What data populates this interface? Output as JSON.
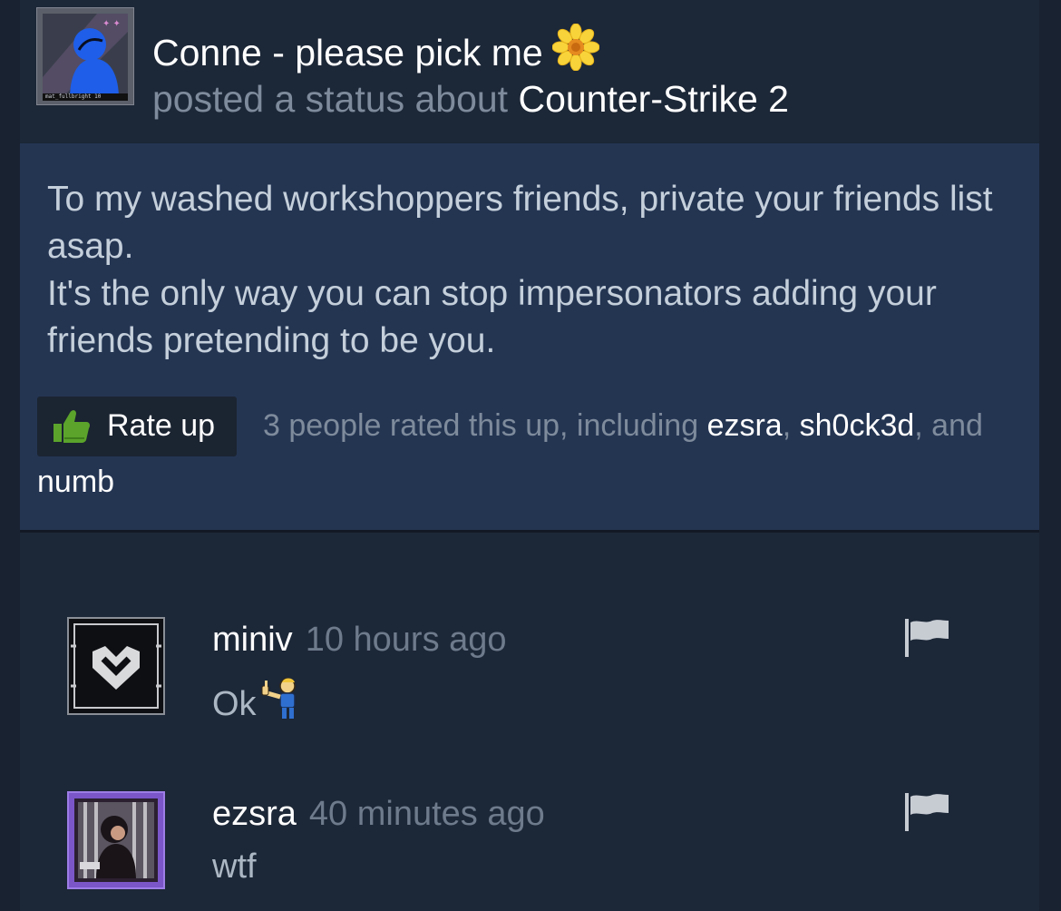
{
  "post": {
    "author": "Conne - please pick me",
    "author_emoji_icon": "sunflower-icon",
    "action_text": "posted a status about",
    "game": "Counter-Strike 2",
    "avatar_caption": "mat_fullbright 10",
    "status_text": "To my washed workshoppers friends, private your friends list asap.\nIt's the only way you can stop impersonators adding your friends pretending to be you.",
    "rate_label": "Rate up",
    "rate_prefix": "3 people rated this up, including",
    "raters": [
      "ezsra",
      "sh0ck3d",
      "numb"
    ],
    "rate_sep": ",",
    "rate_and": ", and"
  },
  "comments": [
    {
      "author": "miniv",
      "time": "10 hours ago",
      "text": "Ok",
      "emoticon_icon": "thumbs-up-vaultboy-icon"
    },
    {
      "author": "ezsra",
      "time": "40 minutes ago",
      "text": "wtf"
    }
  ],
  "colors": {
    "page_bg": "#192231",
    "status_bg": "#243552",
    "muted_text": "#7e8b9c",
    "rate_thumb": "#5ba32b"
  }
}
